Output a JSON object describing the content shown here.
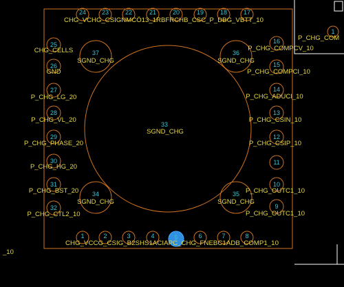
{
  "component": {
    "center_pad": {
      "number": "33",
      "net": "SGND_CHG"
    },
    "corner_pads": [
      {
        "number": "37",
        "net": "SGND_CHG"
      },
      {
        "number": "36",
        "net": "SGND_CHG"
      },
      {
        "number": "34",
        "net": "SGND_CHG"
      },
      {
        "number": "35",
        "net": "SGND_CHG"
      }
    ],
    "left_pads": [
      {
        "number": "25",
        "net": "CHG_CELLS"
      },
      {
        "number": "26",
        "net": "GND"
      },
      {
        "number": "27",
        "net": "P_CHG_LG_20"
      },
      {
        "number": "28",
        "net": "P_CHG_VL_20"
      },
      {
        "number": "29",
        "net": "P_CHG_PHASE_20"
      },
      {
        "number": "30",
        "net": "P_CHG_HG_20"
      },
      {
        "number": "31",
        "net": "P_CHG_BST_20"
      },
      {
        "number": "32",
        "net": "P_CHG_CTL2_10"
      }
    ],
    "right_pads": [
      {
        "number": "16",
        "net": "P_CHG_COMPCV_10"
      },
      {
        "number": "15",
        "net": "P_CHG_COMPCI_10"
      },
      {
        "number": "14",
        "net": "P_CHG_ADUCI_10"
      },
      {
        "number": "13",
        "net": "P_CHG_CSIN_10"
      },
      {
        "number": "12",
        "net": "P_CHG_CSIP_10"
      },
      {
        "number": "11",
        "net": ""
      },
      {
        "number": "10",
        "net": "P_CHG_OUTC1_10"
      },
      {
        "number": "9",
        "net": "P_CHG_OUTC1_10"
      }
    ],
    "top_pads": [
      {
        "number": "24"
      },
      {
        "number": "23"
      },
      {
        "number": "22"
      },
      {
        "number": "21"
      },
      {
        "number": "20"
      },
      {
        "number": "19"
      },
      {
        "number": "18"
      },
      {
        "number": "17"
      }
    ],
    "top_net_text": "CHG_VCHG_CSIGNMCÖ13_1RBFRCHB_CSC_P_DBG_VBTT_10",
    "bottom_pads": [
      {
        "number": "1"
      },
      {
        "number": "2"
      },
      {
        "number": "3"
      },
      {
        "number": "4"
      },
      {
        "number": "5"
      },
      {
        "number": "6"
      },
      {
        "number": "7"
      },
      {
        "number": "8"
      }
    ],
    "bottom_net_text": "CHG_VCCG_CSIG_B2SHS1ACIAPC_CHG_FNEBC1ADB_COMP1_10"
  },
  "neighbors": {
    "right_component_label": "P_CHG_COM",
    "right_component_pin": "1",
    "left_edge_label": "_10"
  },
  "colors": {
    "background": "#000000",
    "outline": "#d2741f",
    "net_label": "#e8d94a",
    "pin_number": "#3ec3d4",
    "highlight": "#2f8fe0"
  }
}
